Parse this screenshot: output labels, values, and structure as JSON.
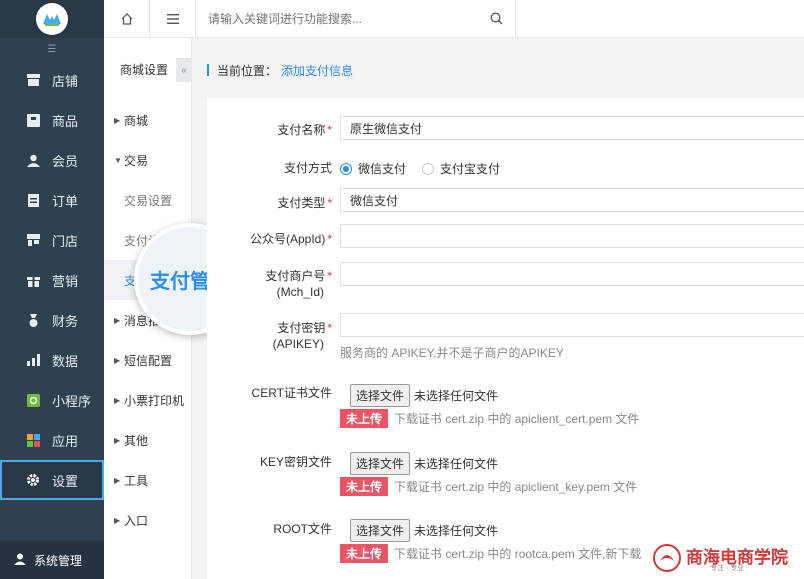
{
  "sidebar": {
    "items": [
      {
        "label": "店铺",
        "icon": "store-icon"
      },
      {
        "label": "商品",
        "icon": "goods-icon"
      },
      {
        "label": "会员",
        "icon": "member-icon"
      },
      {
        "label": "订单",
        "icon": "order-icon"
      },
      {
        "label": "门店",
        "icon": "shop-icon"
      },
      {
        "label": "营销",
        "icon": "gift-icon"
      },
      {
        "label": "财务",
        "icon": "finance-icon"
      },
      {
        "label": "数据",
        "icon": "chart-icon"
      },
      {
        "label": "小程序",
        "icon": "miniapp-icon"
      },
      {
        "label": "应用",
        "icon": "apps-icon"
      },
      {
        "label": "设置",
        "icon": "gear-icon"
      }
    ],
    "system_label": "系统管理"
  },
  "topbar": {
    "search_placeholder": "请输入关键词进行功能搜索..."
  },
  "subside": {
    "title": "商城设置",
    "items": {
      "mall": "商城",
      "trade": "交易",
      "trade_settings": "交易设置",
      "pay_settings": "支付设",
      "pay_manage": "支",
      "message": "消息推",
      "sms": "短信配置",
      "printer": "小票打印机",
      "other": "其他",
      "tools": "工具",
      "entry": "入口"
    }
  },
  "magnifier": {
    "label": "支付管理"
  },
  "breadcrumb": {
    "prefix": "当前位置：",
    "current": "添加支付信息"
  },
  "form": {
    "pay_name_label": "支付名称",
    "pay_name_value": "原生微信支付",
    "pay_method_label": "支付方式",
    "pay_method_options": [
      "微信支付",
      "支付宝支付"
    ],
    "pay_type_label": "支付类型",
    "pay_type_value": "微信支付",
    "appid_label": "公众号(AppId)",
    "mchid_label_1": "支付商户号",
    "mchid_label_2": "(Mch_Id)",
    "apikey_label_1": "支付密钥",
    "apikey_label_2": "(APIKEY)",
    "apikey_hint": "服务商的 APIKEY,并不是子商户的APIKEY",
    "cert_label": "CERT证书文件",
    "key_label": "KEY密钥文件",
    "root_label": "ROOT文件",
    "file_button": "选择文件",
    "file_none": "未选择任何文件",
    "not_uploaded": "未上传",
    "cert_hint": "下载证书 cert.zip 中的 apiclient_cert.pem 文件",
    "key_hint": "下载证书 cert.zip 中的 apiclient_key.pem 文件",
    "root_hint": "下载证书 cert.zip 中的 rootca.pem 文件,新下载"
  },
  "watermark": {
    "text": "商海电商学院",
    "sub": "专注 · 专业"
  },
  "colors": {
    "accent": "#2d8cf0",
    "sidebar": "#2f4050",
    "danger": "#ed5565"
  }
}
